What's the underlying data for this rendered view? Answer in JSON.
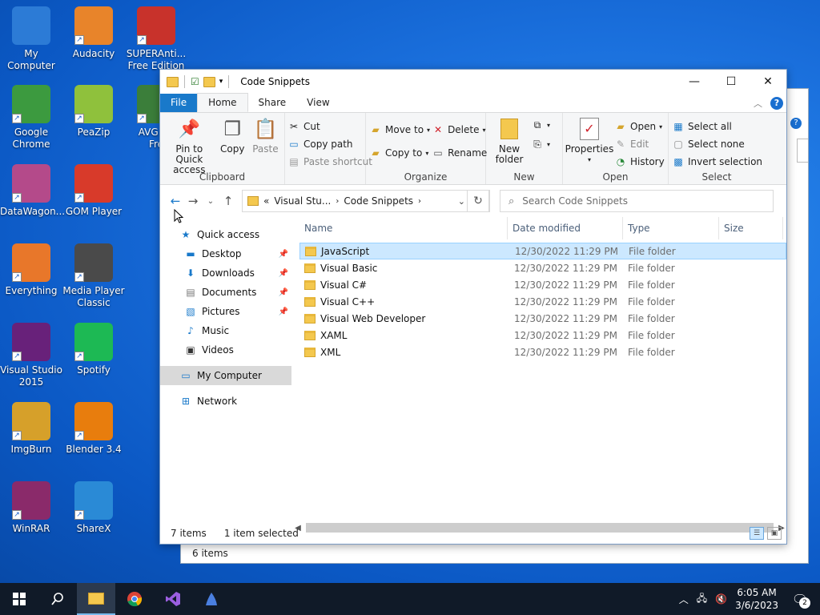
{
  "desktop": {
    "icons": [
      {
        "label": "My Computer",
        "color": "#2c7bd6"
      },
      {
        "label": "Audacity",
        "color": "#e8842a"
      },
      {
        "label": "SUPERAnti...\nFree Edition",
        "color": "#c8322b"
      },
      {
        "label": "Google\nChrome",
        "color": "#3c9a3f"
      },
      {
        "label": "PeaZip",
        "color": "#8fc13c"
      },
      {
        "label": "AVG An\nFre",
        "color": "#3b7e3a"
      },
      {
        "label": "DataWagon...",
        "color": "#b44a8a"
      },
      {
        "label": "GOM Player",
        "color": "#d83a2a"
      },
      {
        "label": "Everything",
        "color": "#e8772a"
      },
      {
        "label": "Media Player\nClassic",
        "color": "#4a4a4a"
      },
      {
        "label": "Visual Studio\n2015",
        "color": "#68217a"
      },
      {
        "label": "Spotify",
        "color": "#1db954"
      },
      {
        "label": "ImgBurn",
        "color": "#d6a02a"
      },
      {
        "label": "Blender 3.4",
        "color": "#e87d0d"
      },
      {
        "label": "WinRAR",
        "color": "#8a2a6a"
      },
      {
        "label": "ShareX",
        "color": "#2a8ad6"
      }
    ]
  },
  "back_window": {
    "status_items": "6 items"
  },
  "explorer": {
    "title": "Code Snippets",
    "window_buttons": {
      "minimize": "—",
      "maximize": "☐",
      "close": "✕"
    },
    "tabs": {
      "file": "File",
      "home": "Home",
      "share": "Share",
      "view": "View"
    },
    "ribbon": {
      "clipboard": {
        "group": "Clipboard",
        "pin": "Pin to Quick access",
        "copy": "Copy",
        "paste": "Paste",
        "cut": "Cut",
        "copy_path": "Copy path",
        "paste_shortcut": "Paste shortcut"
      },
      "organize": {
        "group": "Organize",
        "move_to": "Move to",
        "copy_to": "Copy to",
        "delete": "Delete",
        "rename": "Rename"
      },
      "new": {
        "group": "New",
        "new_folder": "New folder"
      },
      "open": {
        "group": "Open",
        "properties": "Properties",
        "open": "Open",
        "edit": "Edit",
        "history": "History"
      },
      "select": {
        "group": "Select",
        "select_all": "Select all",
        "select_none": "Select none",
        "invert": "Invert selection"
      }
    },
    "address": {
      "prefix": "«",
      "crumb1": "Visual Stu...",
      "crumb2": "Code Snippets"
    },
    "search": {
      "placeholder": "Search Code Snippets"
    },
    "nav": {
      "quick_access": "Quick access",
      "desktop": "Desktop",
      "downloads": "Downloads",
      "documents": "Documents",
      "pictures": "Pictures",
      "music": "Music",
      "videos": "Videos",
      "my_computer": "My Computer",
      "network": "Network"
    },
    "columns": {
      "name": "Name",
      "date": "Date modified",
      "type": "Type",
      "size": "Size"
    },
    "files": [
      {
        "name": "JavaScript",
        "date": "12/30/2022 11:29 PM",
        "type": "File folder"
      },
      {
        "name": "Visual Basic",
        "date": "12/30/2022 11:29 PM",
        "type": "File folder"
      },
      {
        "name": "Visual C#",
        "date": "12/30/2022 11:29 PM",
        "type": "File folder"
      },
      {
        "name": "Visual C++",
        "date": "12/30/2022 11:29 PM",
        "type": "File folder"
      },
      {
        "name": "Visual Web Developer",
        "date": "12/30/2022 11:29 PM",
        "type": "File folder"
      },
      {
        "name": "XAML",
        "date": "12/30/2022 11:29 PM",
        "type": "File folder"
      },
      {
        "name": "XML",
        "date": "12/30/2022 11:29 PM",
        "type": "File folder"
      }
    ],
    "status": {
      "count": "7 items",
      "selected": "1 item selected"
    }
  },
  "taskbar": {
    "time": "6:05 AM",
    "date": "3/6/2023",
    "notifications": "2"
  }
}
